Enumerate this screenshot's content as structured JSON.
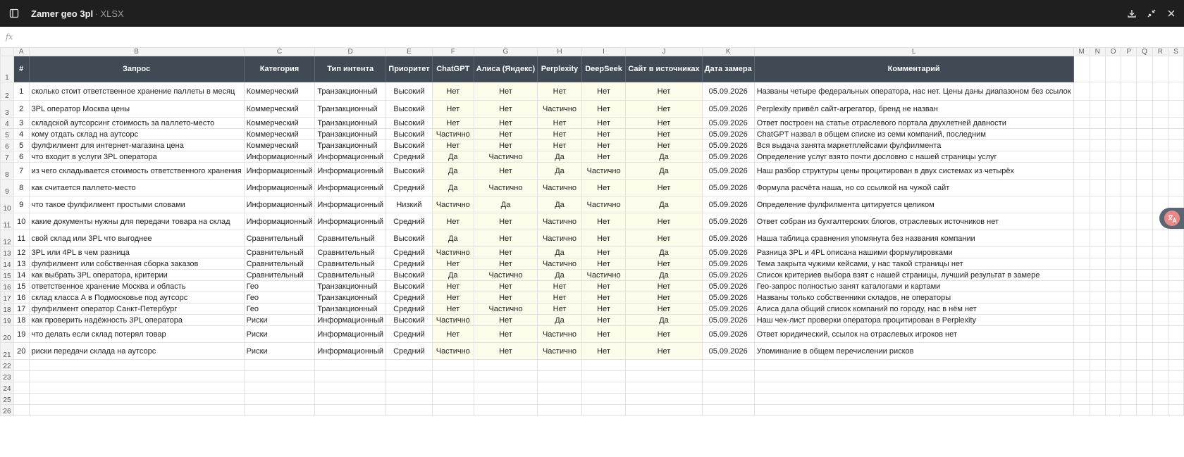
{
  "titlebar": {
    "filename": "Zamer geo 3pl",
    "separator": "·",
    "ext": "XLSX"
  },
  "icons": {
    "sidebar": "sidebar-toggle-icon",
    "download": "download-icon",
    "collapse": "collapse-icon",
    "close": "close-icon",
    "floating": "translate-icon"
  },
  "formula_bar": {
    "label": "fx",
    "value": ""
  },
  "columns": [
    "A",
    "B",
    "C",
    "D",
    "E",
    "F",
    "G",
    "H",
    "I",
    "J",
    "K",
    "L",
    "M",
    "N",
    "O",
    "P",
    "Q",
    "R",
    "S"
  ],
  "headers": [
    "#",
    "Запрос",
    "Категория",
    "Тип интента",
    "Приоритет",
    "ChatGPT",
    "Алиса (Яндекс)",
    "Perplexity",
    "DeepSeek",
    "Сайт в источниках",
    "Дата замера",
    "Комментарий"
  ],
  "rows": [
    [
      "1",
      "сколько стоит ответственное хранение паллеты в месяц",
      "Коммерческий",
      "Транзакционный",
      "Высокий",
      "Нет",
      "Нет",
      "Нет",
      "Нет",
      "Нет",
      "05.09.2026",
      "Названы четыре федеральных оператора, нас нет. Цены даны диапазоном без ссылок"
    ],
    [
      "2",
      "3PL оператор Москва цены",
      "Коммерческий",
      "Транзакционный",
      "Высокий",
      "Нет",
      "Нет",
      "Частично",
      "Нет",
      "Нет",
      "05.09.2026",
      "Perplexity привёл сайт-агрегатор, бренд не назван"
    ],
    [
      "3",
      "складской аутсорсинг стоимость за паллето-место",
      "Коммерческий",
      "Транзакционный",
      "Высокий",
      "Нет",
      "Нет",
      "Нет",
      "Нет",
      "Нет",
      "05.09.2026",
      "Ответ построен на статье отраслевого портала двухлетней давности"
    ],
    [
      "4",
      "кому отдать склад на аутсорс",
      "Коммерческий",
      "Транзакционный",
      "Высокий",
      "Частично",
      "Нет",
      "Нет",
      "Нет",
      "Нет",
      "05.09.2026",
      "ChatGPT назвал в общем списке из семи компаний, последним"
    ],
    [
      "5",
      "фулфилмент для интернет-магазина цена",
      "Коммерческий",
      "Транзакционный",
      "Высокий",
      "Нет",
      "Нет",
      "Нет",
      "Нет",
      "Нет",
      "05.09.2026",
      "Вся выдача занята маркетплейсами фулфилмента"
    ],
    [
      "6",
      "что входит в услуги 3PL оператора",
      "Информационный",
      "Информационный",
      "Средний",
      "Да",
      "Частично",
      "Да",
      "Нет",
      "Да",
      "05.09.2026",
      "Определение услуг взято почти дословно с нашей страницы услуг"
    ],
    [
      "7",
      "из чего складывается стоимость ответственного хранения",
      "Информационный",
      "Информационный",
      "Высокий",
      "Да",
      "Нет",
      "Да",
      "Частично",
      "Да",
      "05.09.2026",
      "Наш разбор структуры цены процитирован в двух системах из четырёх"
    ],
    [
      "8",
      "как считается паллето-место",
      "Информационный",
      "Информационный",
      "Средний",
      "Да",
      "Частично",
      "Частично",
      "Нет",
      "Нет",
      "05.09.2026",
      "Формула расчёта наша, но со ссылкой на чужой сайт"
    ],
    [
      "9",
      "что такое фулфилмент простыми словами",
      "Информационный",
      "Информационный",
      "Низкий",
      "Частично",
      "Да",
      "Да",
      "Частично",
      "Да",
      "05.09.2026",
      "Определение фулфилмента цитируется целиком"
    ],
    [
      "10",
      "какие документы нужны для передачи товара на склад",
      "Информационный",
      "Информационный",
      "Средний",
      "Нет",
      "Нет",
      "Частично",
      "Нет",
      "Нет",
      "05.09.2026",
      "Ответ собран из бухгалтерских блогов, отраслевых источников нет"
    ],
    [
      "11",
      "свой склад или 3PL что выгоднее",
      "Сравнительный",
      "Сравнительный",
      "Высокий",
      "Да",
      "Нет",
      "Частично",
      "Нет",
      "Нет",
      "05.09.2026",
      "Наша таблица сравнения упомянута без названия компании"
    ],
    [
      "12",
      "3PL или 4PL в чем разница",
      "Сравнительный",
      "Сравнительный",
      "Средний",
      "Частично",
      "Нет",
      "Да",
      "Нет",
      "Да",
      "05.09.2026",
      "Разница 3PL и 4PL описана нашими формулировками"
    ],
    [
      "13",
      "фулфилмент или собственная сборка заказов",
      "Сравнительный",
      "Сравнительный",
      "Средний",
      "Нет",
      "Нет",
      "Частично",
      "Нет",
      "Нет",
      "05.09.2026",
      "Тема закрыта чужими кейсами, у нас такой страницы нет"
    ],
    [
      "14",
      "как выбрать 3PL оператора, критерии",
      "Сравнительный",
      "Сравнительный",
      "Высокий",
      "Да",
      "Частично",
      "Да",
      "Частично",
      "Да",
      "05.09.2026",
      "Список критериев выбора взят с нашей страницы, лучший результат в замере"
    ],
    [
      "15",
      "ответственное хранение Москва и область",
      "Гео",
      "Транзакционный",
      "Высокий",
      "Нет",
      "Нет",
      "Нет",
      "Нет",
      "Нет",
      "05.09.2026",
      "Гео-запрос полностью занят каталогами и картами"
    ],
    [
      "16",
      "склад класса А в Подмосковье под аутсорс",
      "Гео",
      "Транзакционный",
      "Средний",
      "Нет",
      "Нет",
      "Нет",
      "Нет",
      "Нет",
      "05.09.2026",
      "Названы только собственники складов, не операторы"
    ],
    [
      "17",
      "фулфилмент оператор Санкт-Петербург",
      "Гео",
      "Транзакционный",
      "Средний",
      "Нет",
      "Частично",
      "Нет",
      "Нет",
      "Нет",
      "05.09.2026",
      "Алиса дала общий список компаний по городу, нас в нём нет"
    ],
    [
      "18",
      "как проверить надёжность 3PL оператора",
      "Риски",
      "Информационный",
      "Высокий",
      "Частично",
      "Нет",
      "Да",
      "Нет",
      "Да",
      "05.09.2026",
      "Наш чек-лист проверки оператора процитирован в Perplexity"
    ],
    [
      "19",
      "что делать если склад потерял товар",
      "Риски",
      "Информационный",
      "Средний",
      "Нет",
      "Нет",
      "Частично",
      "Нет",
      "Нет",
      "05.09.2026",
      "Ответ юридический, ссылок на отраслевых игроков нет"
    ],
    [
      "20",
      "риски передачи склада на аутсорс",
      "Риски",
      "Информационный",
      "Средний",
      "Частично",
      "Нет",
      "Частично",
      "Нет",
      "Нет",
      "05.09.2026",
      "Упоминание в общем перечислении рисков"
    ]
  ],
  "empty_rows": [
    "22",
    "23",
    "24",
    "25",
    "26"
  ]
}
